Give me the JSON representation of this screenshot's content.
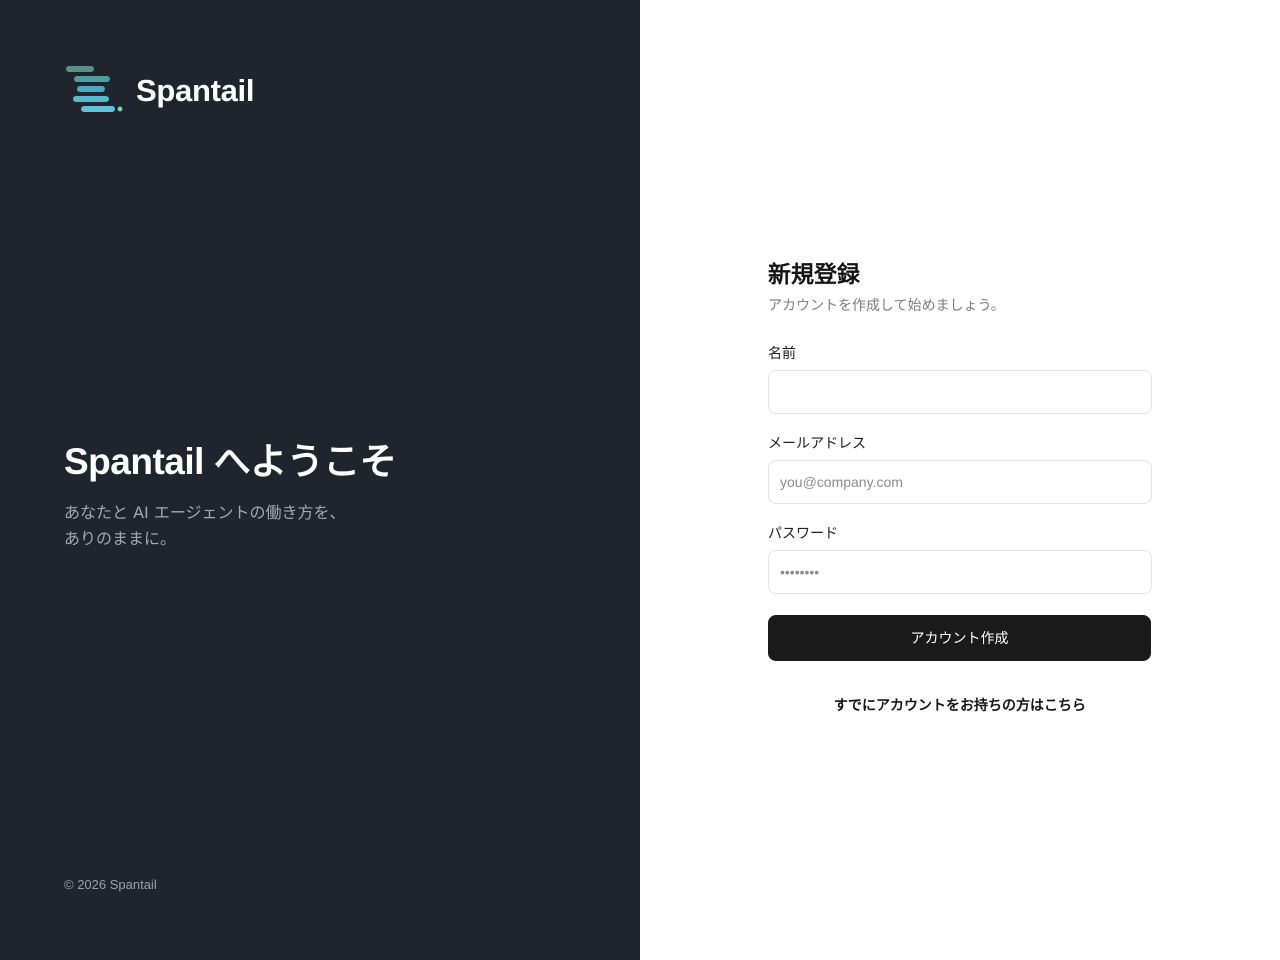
{
  "brand": {
    "name": "Spantail",
    "logo_icon": "stacked-lines-logo-icon",
    "colors": {
      "panel_bg": "#20252d",
      "bar_1": "#5b8f8a",
      "bar_2": "#4f9ea3",
      "bar_3": "#4aa9c7",
      "bar_4": "#58b6cf",
      "bar_5": "#5fc1dc",
      "dot": "#5fe0b8"
    }
  },
  "hero": {
    "title": "Spantail へようこそ",
    "subtitle_line1": "あなたと AI エージェントの働き方を、",
    "subtitle_line2": "ありのままに。"
  },
  "footer": {
    "copyright": "© 2026 Spantail"
  },
  "form": {
    "title": "新規登録",
    "subtitle": "アカウントを作成して始めましょう。",
    "name_field": {
      "label": "名前",
      "value": "",
      "placeholder": ""
    },
    "email_field": {
      "label": "メールアドレス",
      "value": "",
      "placeholder": "you@company.com"
    },
    "password_field": {
      "label": "パスワード",
      "value": "",
      "placeholder": "••••••••"
    },
    "submit_label": "アカウント作成",
    "login_link": "すでにアカウントをお持ちの方はこちら",
    "colors": {
      "button_bg": "#1a1a1a",
      "input_border": "#e3e3e3"
    }
  }
}
